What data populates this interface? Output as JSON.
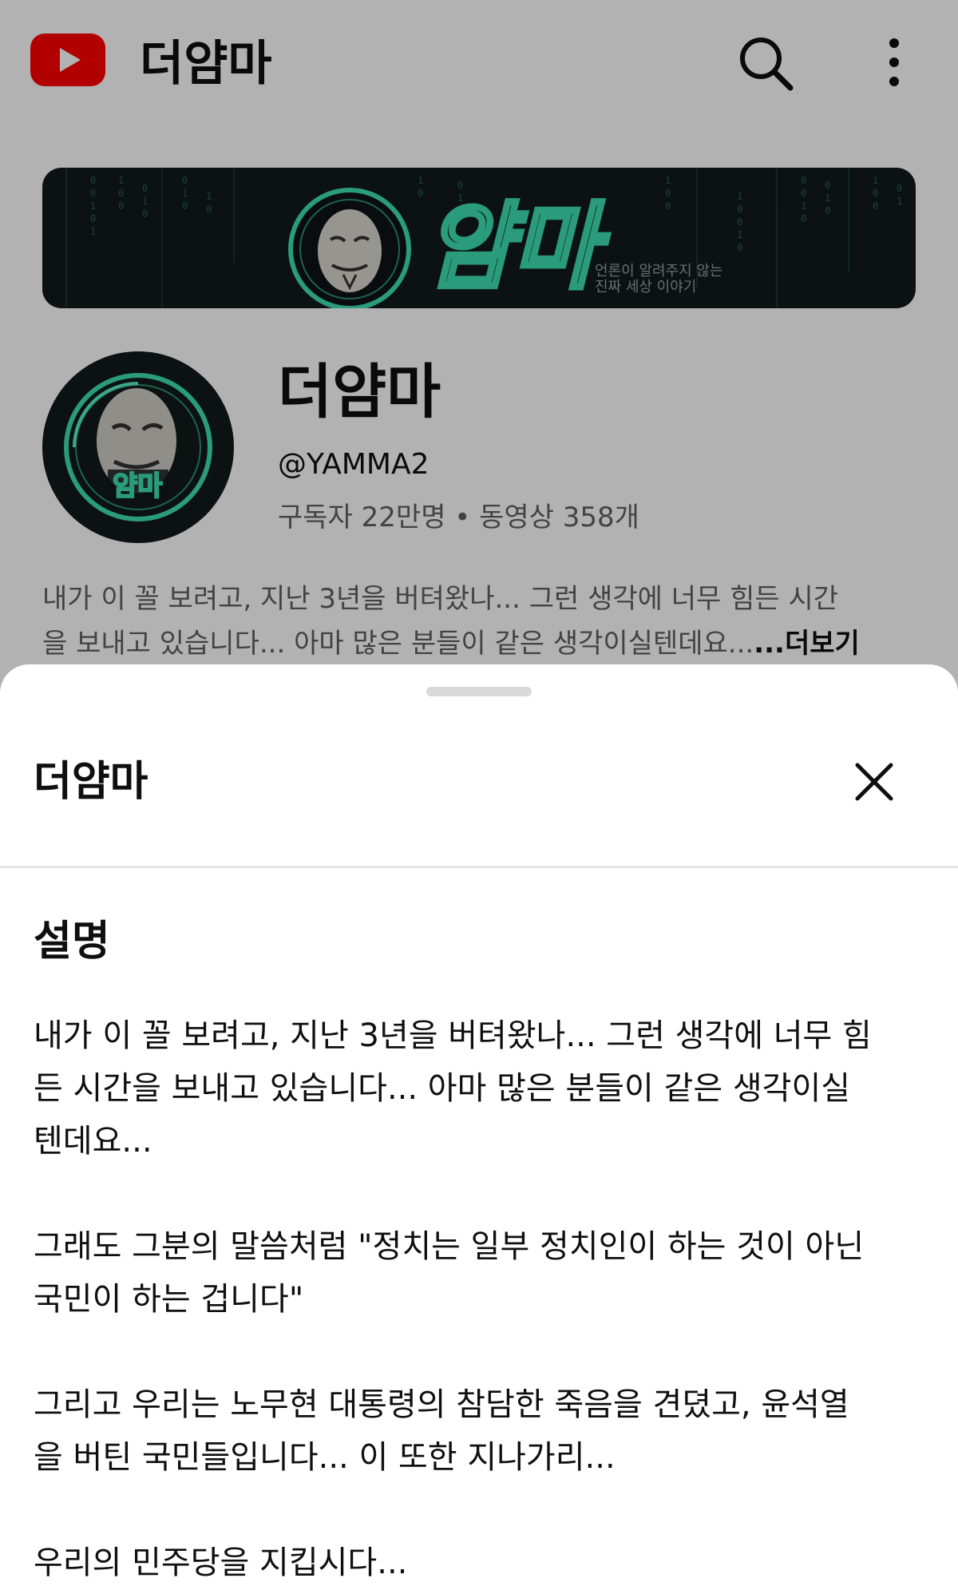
{
  "header": {
    "title": "더얌마",
    "logo_icon": "youtube-logo-icon",
    "search_icon": "search-icon",
    "more_icon": "more-vert-icon",
    "brand_color": "#ff0000"
  },
  "banner": {
    "logo_text": "얌마",
    "tagline": [
      "언론이 알려주지 않는",
      "진짜 세상 이야기"
    ],
    "accent_color": "#3de0b0"
  },
  "channel": {
    "avatar_logo_text": "얌마",
    "name": "더얌마",
    "handle": "@YAMMA2",
    "stats": "구독자 22만명 • 동영상 358개",
    "description_preview": [
      "내가 이 꼴 보려고, 지난 3년을 버텨왔나... 그런 생각에 너무 힘든 시간",
      "을 보내고 있습니다... 아마 많은 분들이 같은 생각이실텐데요..."
    ],
    "more_label": "...더보기"
  },
  "sheet": {
    "title": "더얌마",
    "close_icon": "close-icon",
    "section_title": "설명",
    "paragraphs": [
      [
        "내가 이 꼴 보려고, 지난 3년을 버텨왔나... 그런 생각에 너무 힘",
        "든 시간을 보내고 있습니다... 아마 많은 분들이 같은 생각이실",
        "텐데요..."
      ],
      [
        "그래도 그분의 말씀처럼 \"정치는 일부 정치인이 하는 것이 아닌",
        "국민이 하는 겁니다\""
      ],
      [
        "그리고 우리는 노무현 대통령의 참담한 죽음을 견뎠고, 윤석열",
        "을 버틴 국민들입니다... 이 또한 지나가리..."
      ],
      [
        "우리의 민주당을 지킵시다..."
      ]
    ]
  }
}
